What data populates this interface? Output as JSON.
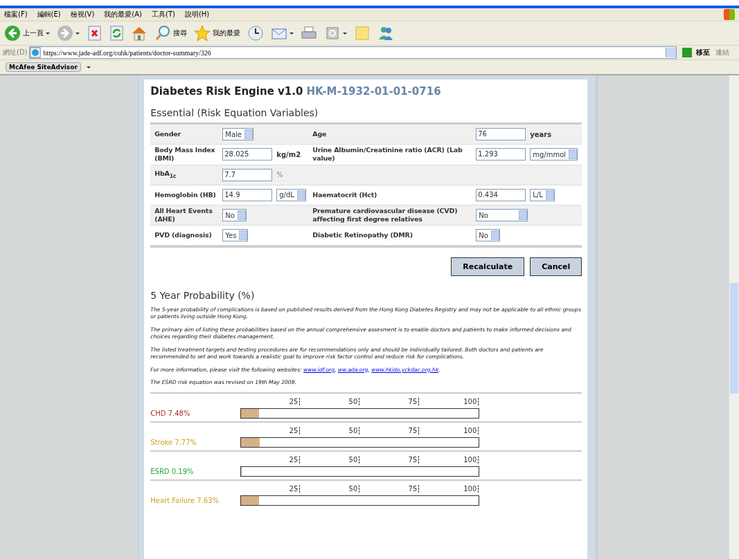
{
  "menu": [
    "檔案(F)",
    "編輯(E)",
    "檢視(V)",
    "我的最愛(A)",
    "工具(T)",
    "說明(H)"
  ],
  "toolbar": [
    {
      "kind": "back",
      "label": "上一頁"
    },
    {
      "kind": "forward"
    },
    {
      "kind": "stop"
    },
    {
      "kind": "refresh"
    },
    {
      "kind": "home"
    },
    {
      "kind": "search",
      "label": "搜尋"
    },
    {
      "kind": "favorites",
      "label": "我的最愛"
    },
    {
      "kind": "history"
    },
    {
      "kind": "mail"
    },
    {
      "kind": "print"
    },
    {
      "kind": "edit"
    },
    {
      "kind": "note"
    },
    {
      "kind": "messenger"
    }
  ],
  "address_bar": {
    "label": "網址(D)",
    "url": "https://www.jade-adf.org/cuhk/patients/doctor-summary/326",
    "go": "移至",
    "links": "連結"
  },
  "addon_bar": {
    "button": "McAfee SiteAdvisor"
  },
  "page": {
    "title": "Diabetes Risk Engine v1.0",
    "patient_id": "HK-M-1932-01-01-0716",
    "section": "Essential (Risk Equation Variables)",
    "rows": [
      {
        "label": "Gender",
        "field": {
          "kind": "select",
          "value": "Male"
        },
        "label2": "Age",
        "field2": {
          "kind": "text",
          "value": "76",
          "unit": "years"
        }
      },
      {
        "label": "Body Mass Index (BMI)",
        "field": {
          "kind": "text",
          "value": "28.025",
          "unit": "kg/m2"
        },
        "label2": "Urine Albumin/Creatinine ratio (ACR) (Lab value)",
        "field2": {
          "kind": "text_select",
          "value": "1.293",
          "unit": "mg/mmol"
        }
      },
      {
        "label": "HbA$_{1c}$",
        "field": {
          "kind": "text",
          "value": "7.7",
          "unit": "%"
        }
      },
      {
        "label": "Hemoglobin (HB)",
        "field": {
          "kind": "text_select",
          "value": "14.9",
          "unit": "g/dL"
        },
        "label2": "Haematocrit (Hct)",
        "field2": {
          "kind": "text_select",
          "value": "0.434",
          "unit": "L/L"
        }
      },
      {
        "label": "All Heart Events (AHE)",
        "field": {
          "kind": "select",
          "value": "No"
        },
        "label2": "Premature cardiovascular disease (CVD) affecting first degree relatives",
        "field2": {
          "kind": "select",
          "value": "No",
          "wide": true
        }
      },
      {
        "label": "PVD (diagnosis)",
        "field": {
          "kind": "select",
          "value": "Yes"
        },
        "label2": "Diabetic Retinopathy (DMR)",
        "field2": {
          "kind": "select",
          "value": "No"
        }
      }
    ],
    "buttons": [
      "Recalculate",
      "Cancel"
    ],
    "probability_title": "5 Year Probability (%)",
    "notes": [
      "The 5-year probability of complications is based on published results derived from the Hong Kong Diabetes Registry and may not be applicable to all ethnic groups or patients living outside Hong Kong.",
      "The primary aim of listing these probabilities based on the annual comprehensive assesment is to enable doctors and patients to make informed decisions and choices regarding their diabetes management.",
      "The listed treatment targets and testing procedures are for recommendations only and should be individually tailored. Both doctors and patients are recommended to set and work towards a realistic goal to improve risk factor control and reduce risk for complications."
    ],
    "more_info": {
      "text": "For more information, please visit the following websites:",
      "links": [
        {
          "text": "www.idf.org",
          "after": ","
        },
        {
          "text": "ww.ada.org",
          "after": ","
        },
        {
          "text": "www.hkido.yckdac.org.hk",
          "after": "."
        }
      ]
    },
    "revision_note": "The ESRD risk equation was revised on 19th May 2008.",
    "risks": [
      {
        "ticks": [
          "25",
          "50",
          "75",
          "100"
        ],
        "label": "CHD 7.48%",
        "color": "#b22a2a",
        "level": 0.0748
      },
      {
        "ticks": [
          "25",
          "50",
          "75",
          "100"
        ],
        "label": "Stroke 7.77%",
        "color": "#d0a020",
        "level": 0.0777
      },
      {
        "ticks": [
          "25",
          "50",
          "75",
          "100"
        ],
        "label": "ESRD 0.19%",
        "color": "#20a830",
        "level": 0.0019
      },
      {
        "ticks": [
          "25",
          "50",
          "75",
          "100"
        ],
        "label": "Heart Failure 7.63%",
        "color": "#d0a020",
        "level": 0.0763
      }
    ]
  }
}
